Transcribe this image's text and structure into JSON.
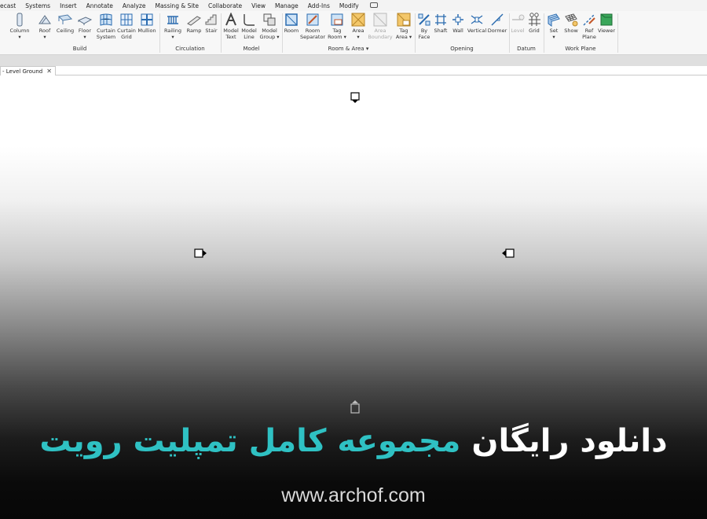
{
  "menu": {
    "items": [
      "ecast",
      "Systems",
      "Insert",
      "Annotate",
      "Analyze",
      "Massing & Site",
      "Collaborate",
      "View",
      "Manage",
      "Add-Ins",
      "Modify"
    ]
  },
  "ribbon": {
    "build": {
      "column": {
        "l1": "Column",
        "l2": "▾"
      },
      "roof": {
        "l1": "Roof",
        "l2": "▾"
      },
      "ceiling": {
        "l1": "Ceiling",
        "l2": ""
      },
      "floor": {
        "l1": "Floor",
        "l2": "▾"
      },
      "curtain_system": {
        "l1": "Curtain",
        "l2": "System"
      },
      "curtain_grid": {
        "l1": "Curtain",
        "l2": "Grid"
      },
      "mullion": {
        "l1": "Mullion",
        "l2": ""
      },
      "label": "Build"
    },
    "circulation": {
      "railing": {
        "l1": "Railing",
        "l2": "▾"
      },
      "ramp": {
        "l1": "Ramp",
        "l2": ""
      },
      "stair": {
        "l1": "Stair",
        "l2": ""
      },
      "label": "Circulation"
    },
    "model": {
      "model_text": {
        "l1": "Model",
        "l2": "Text"
      },
      "model_line": {
        "l1": "Model",
        "l2": "Line"
      },
      "model_group": {
        "l1": "Model",
        "l2": "Group ▾"
      },
      "label": "Model"
    },
    "room_area": {
      "room": {
        "l1": "Room",
        "l2": ""
      },
      "room_separator": {
        "l1": "Room",
        "l2": "Separator"
      },
      "tag_room": {
        "l1": "Tag",
        "l2": "Room ▾"
      },
      "area": {
        "l1": "Area",
        "l2": "▾"
      },
      "area_boundary": {
        "l1": "Area",
        "l2": "Boundary"
      },
      "tag_area": {
        "l1": "Tag",
        "l2": "Area ▾"
      },
      "label": "Room & Area ▾"
    },
    "opening": {
      "by_face": {
        "l1": "By",
        "l2": "Face"
      },
      "shaft": {
        "l1": "Shaft",
        "l2": ""
      },
      "wall": {
        "l1": "Wall",
        "l2": ""
      },
      "vertical": {
        "l1": "Vertical",
        "l2": ""
      },
      "dormer": {
        "l1": "Dormer",
        "l2": ""
      },
      "label": "Opening"
    },
    "datum": {
      "level": {
        "l1": "Level",
        "l2": ""
      },
      "grid": {
        "l1": "Grid",
        "l2": ""
      },
      "label": "Datum"
    },
    "work_plane": {
      "set": {
        "l1": "Set",
        "l2": "▾"
      },
      "show": {
        "l1": "Show",
        "l2": ""
      },
      "ref_plane": {
        "l1": "Ref",
        "l2": "Plane"
      },
      "viewer": {
        "l1": "Viewer",
        "l2": ""
      },
      "label": "Work Plane"
    }
  },
  "document_tab": {
    "label": "- Level Ground",
    "close": "✕"
  },
  "banner": {
    "headline_white": "دانلود رایگان",
    "headline_accent": "مجموعه کامل تمپلیت رویت",
    "url": "www.archof.com",
    "accent_color": "#2fc1c3"
  },
  "icons": [
    "column-icon",
    "roof-icon",
    "ceiling-icon",
    "floor-icon",
    "curtain-system-icon",
    "curtain-grid-icon",
    "mullion-icon",
    "railing-icon",
    "ramp-icon",
    "stair-icon",
    "model-text-icon",
    "model-line-icon",
    "model-group-icon",
    "room-icon",
    "room-separator-icon",
    "tag-room-icon",
    "area-icon",
    "area-boundary-icon",
    "tag-area-icon",
    "by-face-icon",
    "shaft-icon",
    "wall-opening-icon",
    "vertical-icon",
    "dormer-icon",
    "level-icon",
    "grid-icon",
    "set-icon",
    "show-icon",
    "ref-plane-icon",
    "viewer-icon",
    "elevation-marker-icon"
  ]
}
